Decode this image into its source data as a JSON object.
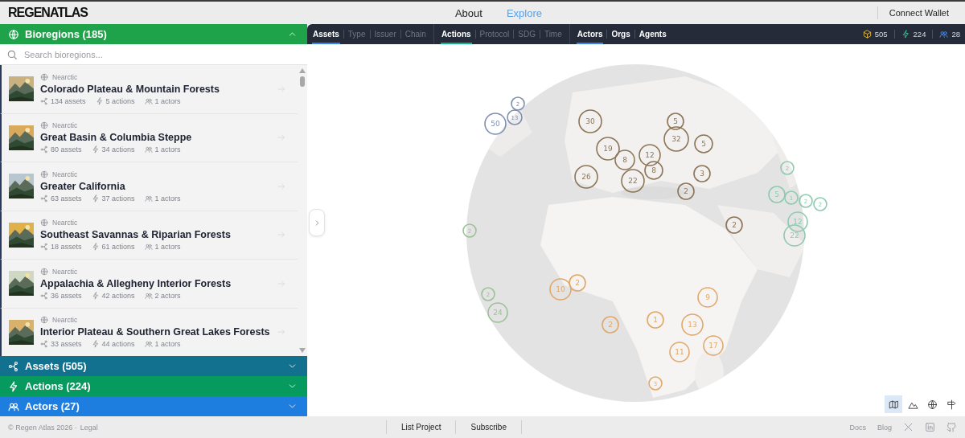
{
  "header": {
    "logo": "REGENATLAS",
    "nav": [
      {
        "label": "About",
        "selected": false
      },
      {
        "label": "Explore",
        "selected": true
      }
    ],
    "wallet_button": "Connect Wallet"
  },
  "bioregions": {
    "title": "Bioregions (185)",
    "expanded": true,
    "search": {
      "placeholder": "Search bioregions..."
    },
    "items": [
      {
        "realm": "Nearctic",
        "name": "Colorado Plateau & Mountain Forests",
        "assets": "134 assets",
        "actions": "5 actions",
        "actors": "1 actors"
      },
      {
        "realm": "Nearctic",
        "name": "Great Basin & Columbia Steppe",
        "assets": "80 assets",
        "actions": "34 actions",
        "actors": "1 actors"
      },
      {
        "realm": "Nearctic",
        "name": "Greater California",
        "assets": "63 assets",
        "actions": "37 actions",
        "actors": "1 actors"
      },
      {
        "realm": "Nearctic",
        "name": "Southeast Savannas & Riparian Forests",
        "assets": "18 assets",
        "actions": "61 actions",
        "actors": "1 actors"
      },
      {
        "realm": "Nearctic",
        "name": "Appalachia & Allegheny Interior Forests",
        "assets": "36 assets",
        "actions": "42 actions",
        "actors": "2 actors"
      },
      {
        "realm": "Nearctic",
        "name": "Interior Plateau & Southern Great Lakes Forests",
        "assets": "33 assets",
        "actions": "44 actions",
        "actors": "1 actors"
      }
    ]
  },
  "sections": [
    {
      "kind": "assets",
      "title": "Assets (505)",
      "expanded": false,
      "color": "#12718f"
    },
    {
      "kind": "actions",
      "title": "Actions (224)",
      "expanded": false,
      "color": "#079a5f"
    },
    {
      "kind": "actors",
      "title": "Actors (27)",
      "expanded": false,
      "color": "#1d7ee0"
    }
  ],
  "layer_tabs": [
    {
      "items": [
        {
          "label": "Assets",
          "kind": "head",
          "selected": true,
          "color": "#3b82f6"
        },
        {
          "label": "Type",
          "kind": "filter",
          "active": false
        },
        {
          "label": "Issuer",
          "kind": "filter",
          "active": false
        },
        {
          "label": "Chain",
          "kind": "filter",
          "active": false
        }
      ]
    },
    {
      "items": [
        {
          "label": "Actions",
          "kind": "head",
          "selected": true,
          "color": "#10b981"
        },
        {
          "label": "Protocol",
          "kind": "filter",
          "active": false
        },
        {
          "label": "SDG",
          "kind": "filter",
          "active": false
        },
        {
          "label": "Time",
          "kind": "filter",
          "active": false
        }
      ]
    },
    {
      "items": [
        {
          "label": "Actors",
          "kind": "head",
          "selected": true,
          "color": "#3b82f6"
        },
        {
          "label": "Orgs",
          "kind": "filter",
          "active": true
        },
        {
          "label": "Agents",
          "kind": "filter",
          "active": true
        }
      ]
    }
  ],
  "stats": [
    {
      "kind": "assets",
      "value": "505"
    },
    {
      "kind": "actions",
      "value": "224"
    },
    {
      "kind": "actors",
      "value": "28"
    }
  ],
  "map": {
    "markers": [
      {
        "label": "2",
        "color": "#7f8fb0"
      },
      {
        "label": "50",
        "color": "#7f8fb0"
      },
      {
        "label": "13",
        "color": "#7f8fb0"
      },
      {
        "label": "30",
        "color": "#8c7659"
      },
      {
        "label": "5",
        "color": "#8c7659"
      },
      {
        "label": "32",
        "color": "#8c7659"
      },
      {
        "label": "19",
        "color": "#8c7659"
      },
      {
        "label": "8",
        "color": "#8c7659"
      },
      {
        "label": "12",
        "color": "#8c7659"
      },
      {
        "label": "8",
        "color": "#8c7659"
      },
      {
        "label": "5",
        "color": "#8c7659"
      },
      {
        "label": "26",
        "color": "#8c7659"
      },
      {
        "label": "22",
        "color": "#8c7659"
      },
      {
        "label": "3",
        "color": "#8c7659"
      },
      {
        "label": "2",
        "color": "#8c7659"
      },
      {
        "label": "2",
        "color": "#8c7659"
      },
      {
        "label": "2",
        "color": "#8fc9b0"
      },
      {
        "label": "5",
        "color": "#8fc9b0"
      },
      {
        "label": "1",
        "color": "#8fc9b0"
      },
      {
        "label": "2",
        "color": "#8fc9b0"
      },
      {
        "label": "2",
        "color": "#8fc9b0"
      },
      {
        "label": "12",
        "color": "#8fc9b0"
      },
      {
        "label": "22",
        "color": "#8fc9b0"
      },
      {
        "label": "2",
        "color": "#9cc198"
      },
      {
        "label": "2",
        "color": "#9cc198"
      },
      {
        "label": "24",
        "color": "#9cc198"
      },
      {
        "label": "10",
        "color": "#e0a86a"
      },
      {
        "label": "2",
        "color": "#e0a86a"
      },
      {
        "label": "9",
        "color": "#e0a86a"
      },
      {
        "label": "2",
        "color": "#e0a86a"
      },
      {
        "label": "1",
        "color": "#e0a86a"
      },
      {
        "label": "13",
        "color": "#e0a86a"
      },
      {
        "label": "17",
        "color": "#e0a86a"
      },
      {
        "label": "11",
        "color": "#e0a86a"
      },
      {
        "label": "3",
        "color": "#e0a86a"
      }
    ]
  },
  "view_buttons": [
    {
      "kind": "map",
      "selected": true
    },
    {
      "kind": "terrain",
      "selected": false
    },
    {
      "kind": "globe",
      "selected": false
    },
    {
      "kind": "signpost",
      "selected": false
    }
  ],
  "footer": {
    "copyright": "© Regen Atlas 2026 ·",
    "legal": "Legal",
    "center_links": [
      "List Project",
      "Subscribe"
    ],
    "right_links": [
      "Docs",
      "Blog"
    ]
  }
}
